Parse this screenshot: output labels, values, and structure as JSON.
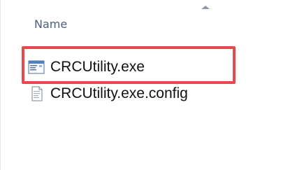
{
  "column_header": {
    "name_label": "Name",
    "sort_icon": "sort-ascending-icon"
  },
  "files": [
    {
      "name": "CRCUtility.exe",
      "icon": "application-icon",
      "highlighted": true
    },
    {
      "name": "CRCUtility.exe.config",
      "icon": "document-icon",
      "highlighted": false
    }
  ],
  "colors": {
    "highlight": "#e5484d",
    "header_text": "#4a5f80",
    "text": "#111111"
  }
}
